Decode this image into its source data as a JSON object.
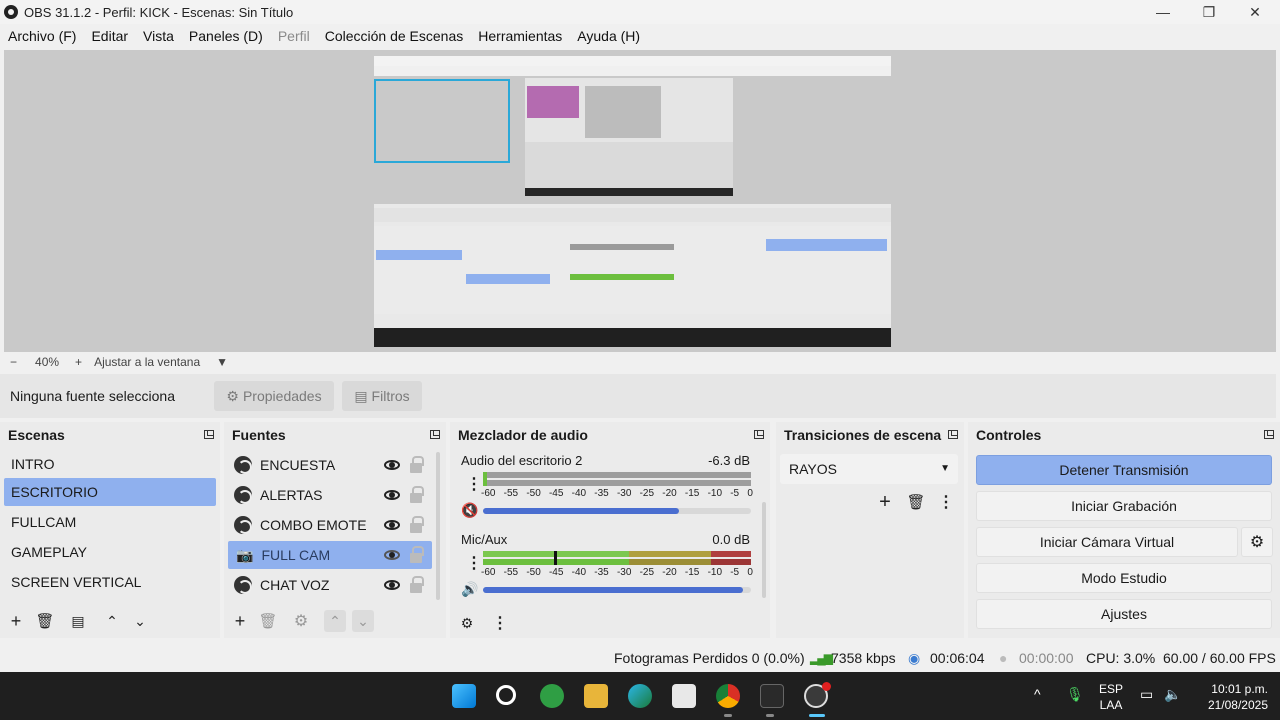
{
  "window": {
    "title": "OBS 31.1.2 - Perfil: KICK - Escenas: Sin Título",
    "minimize_glyph": "—",
    "maximize_glyph": "❐",
    "close_glyph": "✕"
  },
  "menu": [
    "Archivo (F)",
    "Editar",
    "Vista",
    "Paneles (D)",
    "Perfil",
    "Colección de Escenas",
    "Herramientas",
    "Ayuda (H)"
  ],
  "zoom": {
    "minus": "−",
    "level": "40%",
    "plus": "+",
    "fit": "Ajustar a la ventana",
    "dropdown": "▼"
  },
  "source_toolbar": {
    "no_selection": "Ninguna fuente selecciona",
    "properties": "Propiedades",
    "filters": "Filtros"
  },
  "scenes": {
    "title": "Escenas",
    "items": [
      "INTRO",
      "ESCRITORIO",
      "FULLCAM",
      "GAMEPLAY",
      "SCREEN VERTICAL"
    ],
    "selected_index": 1
  },
  "sources": {
    "title": "Fuentes",
    "items": [
      {
        "label": "ENCUESTA",
        "icon": "browser-source-icon"
      },
      {
        "label": "ALERTAS",
        "icon": "browser-source-icon"
      },
      {
        "label": "COMBO EMOTE",
        "icon": "browser-source-icon"
      },
      {
        "label": "FULL CAM",
        "icon": "camera-icon"
      },
      {
        "label": "CHAT VOZ",
        "icon": "browser-source-icon"
      }
    ],
    "selected_index": 3
  },
  "mixer": {
    "title": "Mezclador de audio",
    "channels": [
      {
        "name": "Audio del escritorio 2",
        "db": "-6.3 dB",
        "muted": true,
        "volume_fraction": 0.73
      },
      {
        "name": "Mic/Aux",
        "db": "0.0 dB",
        "muted": false,
        "volume_fraction": 0.97
      }
    ],
    "ticks": [
      "-60",
      "-55",
      "-50",
      "-45",
      "-40",
      "-35",
      "-30",
      "-25",
      "-20",
      "-15",
      "-10",
      "-5",
      "0"
    ]
  },
  "transitions": {
    "title": "Transiciones de escena",
    "selected": "RAYOS"
  },
  "controls": {
    "title": "Controles",
    "stop_stream": "Detener Transmisión",
    "start_recording": "Iniciar Grabación",
    "start_virtual_cam": "Iniciar Cámara Virtual",
    "studio_mode": "Modo Estudio",
    "settings": "Ajustes"
  },
  "status": {
    "dropped_frames": "Fotogramas Perdidos 0 (0.0%)",
    "bitrate": "7358 kbps",
    "stream_time": "00:06:04",
    "record_time": "00:00:00",
    "cpu": "CPU: 3.0%",
    "fps": "60.00 / 60.00 FPS"
  },
  "taskbar": {
    "lang_top": "ESP",
    "lang_bottom": "LAA",
    "time": "10:01 p.m.",
    "date": "21/08/2025",
    "tray_arrow": "^"
  },
  "colors": {
    "accent": "#8fb0ee",
    "meter_green": "#6cbf3e",
    "meter_yellow": "#b0a040",
    "meter_red": "#b04040",
    "volume_blue": "#4a6ed0",
    "taskbar": "#1f1f1f"
  }
}
